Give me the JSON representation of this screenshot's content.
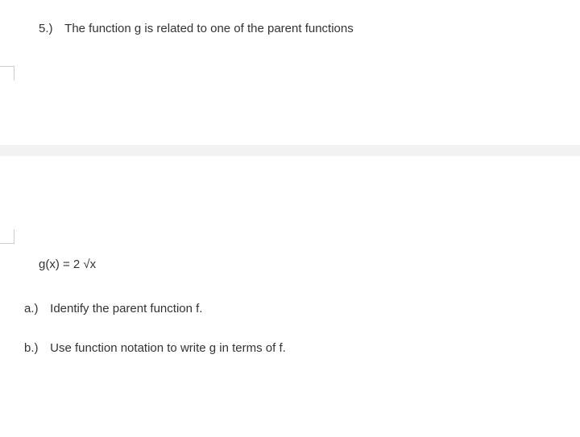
{
  "question": {
    "number": "5.)",
    "prompt": "The function g is related to one of the parent functions"
  },
  "equation": "g(x) = 2 √x",
  "parts": {
    "a": {
      "label": "a.)",
      "text": "Identify the parent function f."
    },
    "b": {
      "label": "b.)",
      "text": "Use function notation to write g in terms of f."
    }
  }
}
